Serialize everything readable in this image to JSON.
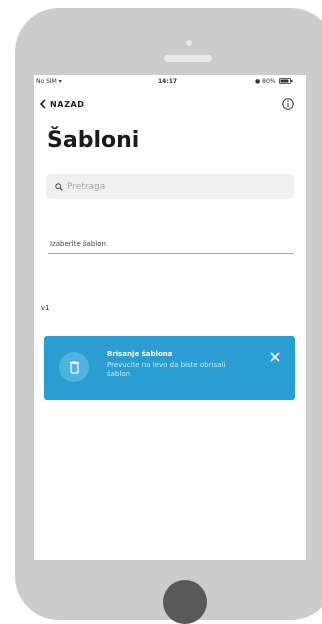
{
  "statusbar": {
    "carrier": "No SIM ▾",
    "time": "14:17",
    "battery": "● 80%"
  },
  "nav": {
    "back_label": "NAZAD",
    "back_icon": "chevron-left-icon",
    "info_icon": "info-icon"
  },
  "page": {
    "title": "Šabloni"
  },
  "search": {
    "placeholder": "Pretraga",
    "value": ""
  },
  "selected": {
    "label": "Izaberite šablon"
  },
  "list": {
    "items": [
      "v1"
    ]
  },
  "toast": {
    "title": "Brisanje šablona",
    "message": "Prevucite na levo da biste obrisali šablon",
    "icon": "trash-icon",
    "close_icon": "close-icon",
    "color": "#2a9ed0"
  },
  "colors": {
    "phone_body": "#cccccc",
    "home_button": "#595959",
    "accent": "#2a9ed0"
  }
}
